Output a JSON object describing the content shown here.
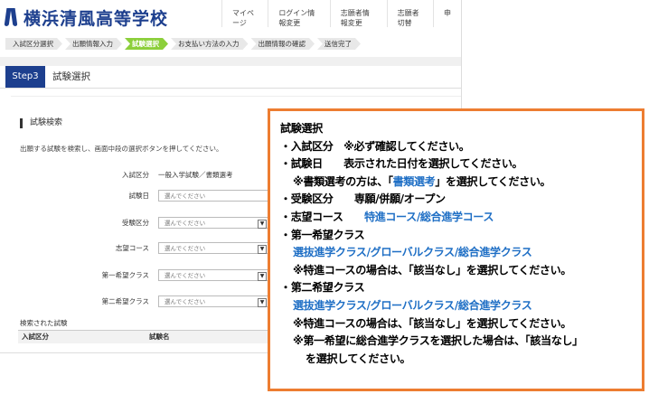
{
  "header": {
    "school_name": "横浜清風高等学校",
    "nav": [
      "マイページ",
      "ログイン情報変更",
      "志願者情報変更",
      "志願者切替",
      "申"
    ]
  },
  "steps": [
    "入試区分選択",
    "出願情報入力",
    "試験選択",
    "お支払い方法の入力",
    "出願情報の確認",
    "送信完了"
  ],
  "active_step_index": 2,
  "step_header": {
    "badge": "Step3",
    "title": "試験選択"
  },
  "search": {
    "section_title": "試験検索",
    "description": "出願する試験を検索し、画面中段の選択ボタンを押してください。",
    "fields": {
      "exam_category": {
        "label": "入試区分",
        "value": "一般入学試験／書類選考"
      },
      "exam_date": {
        "label": "試験日",
        "placeholder": "選んでください"
      },
      "application_type": {
        "label": "受験区分",
        "placeholder": "選んでください"
      },
      "desired_course": {
        "label": "志望コース",
        "placeholder": "選んでください"
      },
      "first_choice_class": {
        "label": "第一希望クラス",
        "placeholder": "選んでください"
      },
      "second_choice_class": {
        "label": "第二希望クラス",
        "placeholder": "選んでください"
      }
    }
  },
  "results": {
    "label": "検索された試験",
    "columns": [
      "入試区分",
      "試験名"
    ]
  },
  "annotation": {
    "title": "試験選択",
    "lines": [
      {
        "a": "・入試区分　※必ず確認してください。"
      },
      {
        "a": "・試験日　　表示された日付を選択してください。"
      },
      {
        "a": "※書類選考の方は、「",
        "b": "書類選考",
        "c": "」を選択してください。"
      },
      {
        "a": "・受験区分　　専願/併願/オープン"
      },
      {
        "a": "・志望コース　　",
        "b": "特進コース/総合進学コース"
      },
      {
        "a": "・第一希望クラス"
      },
      {
        "b": "選抜進学クラス/グローバルクラス/総合進学クラス"
      },
      {
        "a": "※特進コースの場合は、「該当なし」を選択してください。"
      },
      {
        "a": "・第二希望クラス"
      },
      {
        "b": "選抜進学クラス/グローバルクラス/総合進学クラス"
      },
      {
        "a": "※特進コースの場合は、「該当なし」を選択してください。"
      },
      {
        "a": "※第一希望に総合進学クラスを選択した場合は、「該当なし」"
      },
      {
        "a": "を選択してください。"
      }
    ]
  },
  "colors": {
    "brand": "#1d3f8e",
    "active_step": "#8ccf3b",
    "note_border": "#ed7d31",
    "note_highlight": "#1f6fc5"
  }
}
